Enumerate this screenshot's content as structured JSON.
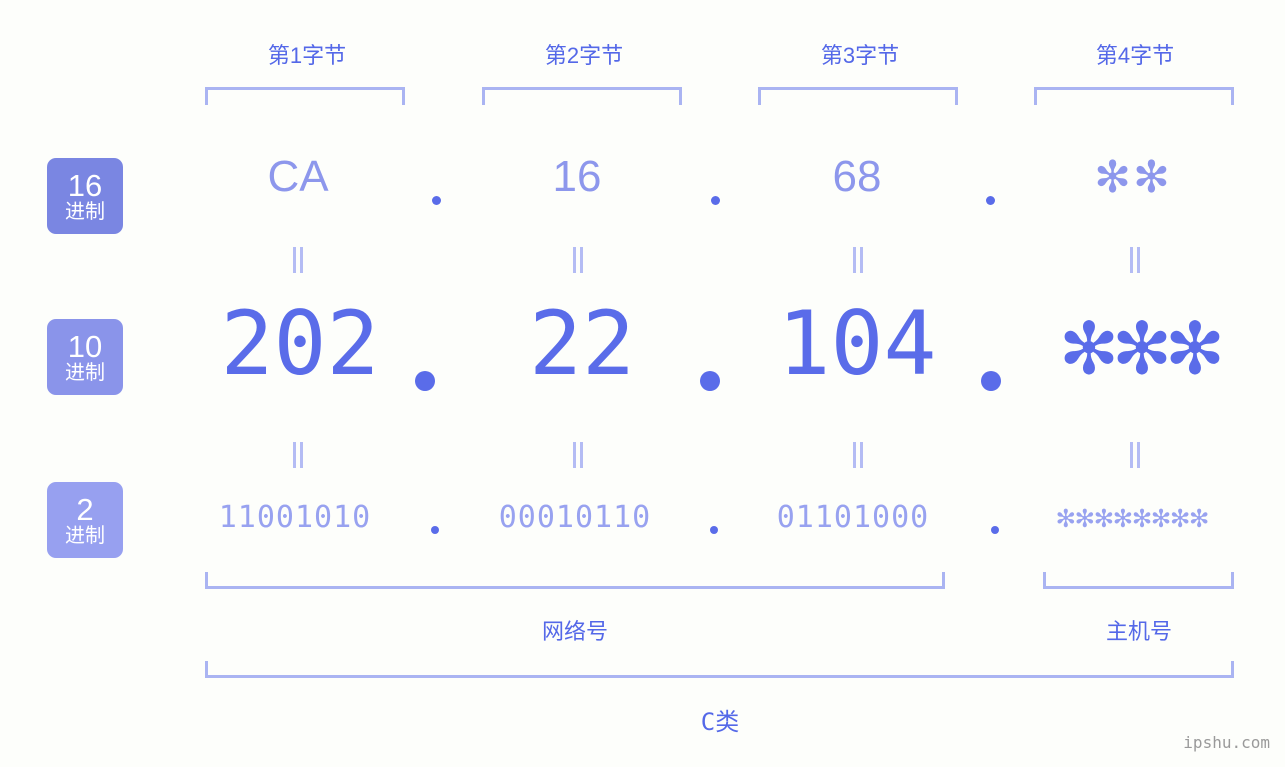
{
  "meta": {
    "watermark": "ipshu.com"
  },
  "byte_headers": [
    {
      "label": "第1字节"
    },
    {
      "label": "第2字节"
    },
    {
      "label": "第3字节"
    },
    {
      "label": "第4字节"
    }
  ],
  "radix_badges": [
    {
      "num": "16",
      "system": "进制",
      "color": "#7a86e2"
    },
    {
      "num": "10",
      "system": "进制",
      "color": "#8a94ea"
    },
    {
      "num": "2",
      "system": "进制",
      "color": "#97a0f0"
    }
  ],
  "rows": {
    "hex": {
      "radix": "16",
      "values": [
        "CA",
        "16",
        "68",
        "✻✻"
      ],
      "separator": "."
    },
    "decimal": {
      "radix": "10",
      "values": [
        "202",
        "22",
        "104",
        "✻✻✻"
      ],
      "separator": "."
    },
    "binary": {
      "radix": "2",
      "values": [
        "11001010",
        "00010110",
        "01101000",
        "✻✻✻✻✻✻✻✻"
      ],
      "separator": "."
    }
  },
  "equality_marks": {
    "glyph": "=",
    "count_per_gap": 4
  },
  "sections": [
    {
      "label": "网络号"
    },
    {
      "label": "主机号"
    }
  ],
  "ip_class": {
    "label": "C类"
  },
  "colors": {
    "background": "#fdfefb",
    "accent_strong": "#5468e8",
    "accent_medium": "#8d97ec",
    "accent_light": "#aab4f2",
    "badge_dark": "#7a86e2",
    "badge_mid": "#8a94ea",
    "badge_light": "#97a0f0",
    "watermark": "#9a9a9a"
  }
}
